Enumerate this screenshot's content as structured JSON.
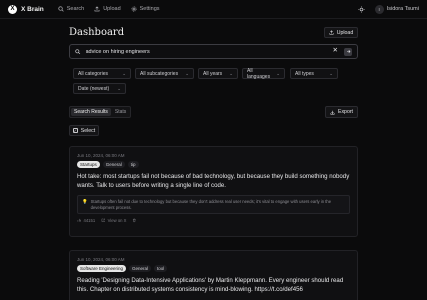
{
  "app": {
    "name": "X Brain",
    "logo_letter": "X"
  },
  "nav": [
    {
      "label": "Search",
      "icon": "search-icon"
    },
    {
      "label": "Upload",
      "icon": "upload-icon"
    },
    {
      "label": "Settings",
      "icon": "gear-icon"
    }
  ],
  "user": {
    "name": "Isidora Tsumi",
    "initial": "I"
  },
  "page": {
    "title": "Dashboard",
    "upload_label": "Upload"
  },
  "search": {
    "value": "advice on hiring engineers",
    "placeholder": "Search"
  },
  "filters": [
    "All categories",
    "All subcategories",
    "All years",
    "All languages",
    "All types",
    "Date (newest)"
  ],
  "tabs": [
    {
      "label": "Search Results",
      "active": true
    },
    {
      "label": "Stats",
      "active": false
    }
  ],
  "export_label": "Export",
  "select_label": "Select",
  "results": [
    {
      "date": "Jun 10, 2024, 06:00 AM",
      "tags": [
        "Startups",
        "General",
        "tip"
      ],
      "text": "Hot take: most startups fail not because of bad technology, but because they build something nobody wants. Talk to users before writing a single line of code.",
      "summary": "Startups often fail not due to technology but because they don't address real user needs; it's vital to engage with users early in the development process.",
      "stat": "44151",
      "view_label": "View on X"
    },
    {
      "date": "Jun 10, 2024, 06:00 AM",
      "tags": [
        "Software Engineering",
        "General",
        "tool"
      ],
      "text": "Reading 'Designing Data-Intensive Applications' by Martin Kleppmann. Every engineer should read this. Chapter on distributed systems consistency is mind-blowing. https://t.co/def456"
    }
  ],
  "colors": {
    "background": "#0b0b0c",
    "accent": "#e6e6e6",
    "bulb": "#d4a017"
  }
}
